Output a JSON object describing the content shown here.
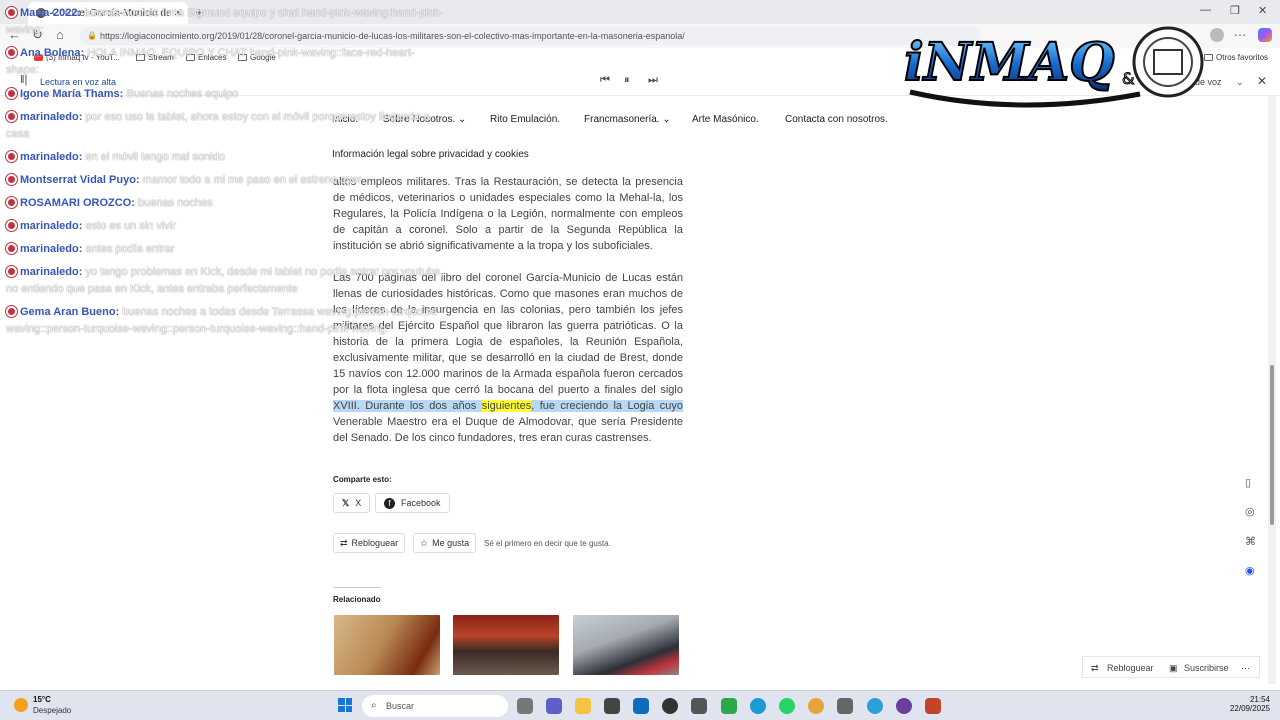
{
  "browser": {
    "tab_title": "Coronel García-Municio de",
    "url": "https://logiaconocimiento.org/2019/01/28/coronel-garcia-municio-de-lucas-los-militares-son-el-colectivo-mas-importante-en-la-masoneria-espanola/",
    "favorites": [
      "(3) Inmaq tv - YouT...",
      "Stream",
      "Enlaces",
      "Google"
    ],
    "other_favorites": "Otros favoritos",
    "reader_label": "Lectura en voz alta",
    "voices_label": "s de voz"
  },
  "site_nav": {
    "items": [
      "Inicio.",
      "Sobre Nosotros.",
      "Rito Emulación.",
      "Francmasonería.",
      "Arte Masónico.",
      "Contacta con nosotros."
    ],
    "legal": "Información legal sobre privacidad y cookies"
  },
  "article": {
    "p1": "altos empleos militares. Tras la Restauración, se detecta la presencia de médicos, veterinarios o unidades especiales como la Mehal-la, los Regulares, la Policía Indígena o la Legión, normalmente con empleos de capitán a coronel. Solo a partir de la Segunda República la institución se abrió significativamente a la tropa y los suboficiales.",
    "p2_a": "Las 700 páginas del libro del coronel García-Municio de Lucas están llenas de curiosidades históricas. Como que masones eran muchos de los líderes de la insurgencia en las colonias, pero también los jefes militares del Ejército Español que libraron las guerra patrióticas. O la historia de la primera Logia de españoles, la Reunión Española, exclusivamente militar, que se desarrolló en la ciudad de Brest, donde 15 navíos con 12.000 marinos de la Armada española fueron cercados por la flota inglesa que cerró la bocana del puerto a finales del siglo ",
    "p2_hl1": "XVIII. Durante los dos años ",
    "p2_hl_word": "siguientes",
    "p2_hl2": ", fue creciendo la Logia cuyo",
    "p2_b": " Venerable Maestro era el Duque de Almodovar, que sería Presidente del Senado. De los cinco fundadores, tres eran curas castrenses."
  },
  "share": {
    "title": "Comparte esto:",
    "x_label": "X",
    "facebook_label": "Facebook",
    "reblog_label": "Rebloguear",
    "like_label": "Me gusta",
    "like_note": "Sé el primero en decir que te gusta."
  },
  "related": {
    "title": "Relacionado"
  },
  "footer_bar": {
    "reblog": "Rebloguear",
    "subscribe": "Suscribirse"
  },
  "chat": [
    {
      "who": "Marta-2022",
      "msg": "buenas noches Irma Sigmund equipo y chat hand-pink-waving:hand-pink-waving:"
    },
    {
      "who": "Ana Bolena",
      "msg": "HOLA INMAQ, EQUIPO Y CHAT hand-pink-waving::face-red-heart-shape:"
    },
    {
      "who": "Igone María Thams",
      "msg": "Buenas noches equipo"
    },
    {
      "who": "marinaledo",
      "msg": "por eso uso la tablet, ahora estoy con el móvil porque estoy llegando a casa"
    },
    {
      "who": "marinaledo",
      "msg": "en el móvil tengo mal sonido"
    },
    {
      "who": "Montserrat Vidal Puyo",
      "msg": "mamor todo a mi me paso en el estreno ayer"
    },
    {
      "who": "ROSAMARI OROZCO",
      "msg": "buenas noches"
    },
    {
      "who": "marinaledo",
      "msg": "esto es un sin vivir"
    },
    {
      "who": "marinaledo",
      "msg": "antes podía entrar"
    },
    {
      "who": "marinaledo",
      "msg": "yo tengo problemas en Kick, desde mi tablet no podia entrar por youtube, no entiendo que pasa en Kick, antes entraba perfectamente"
    },
    {
      "who": "Gema Aran Bueno",
      "msg": "buenas noches a todas desde Terrassa waving:person-turquoise-waving::person-turquoise-waving::person-turquoise-waving::hand-pink-waving:"
    }
  ],
  "logo": {
    "text": "iNMAQ",
    "amp": "&"
  },
  "taskbar": {
    "temp": "15°C",
    "weather": "Despejado",
    "search_placeholder": "Buscar",
    "time": "21:54",
    "date": "22/09/2025"
  },
  "colors": {
    "chat_name": "#3556b8",
    "highlight": "#b9d8f5",
    "highlight_word": "#ffff33",
    "badge": "#c4303c"
  }
}
